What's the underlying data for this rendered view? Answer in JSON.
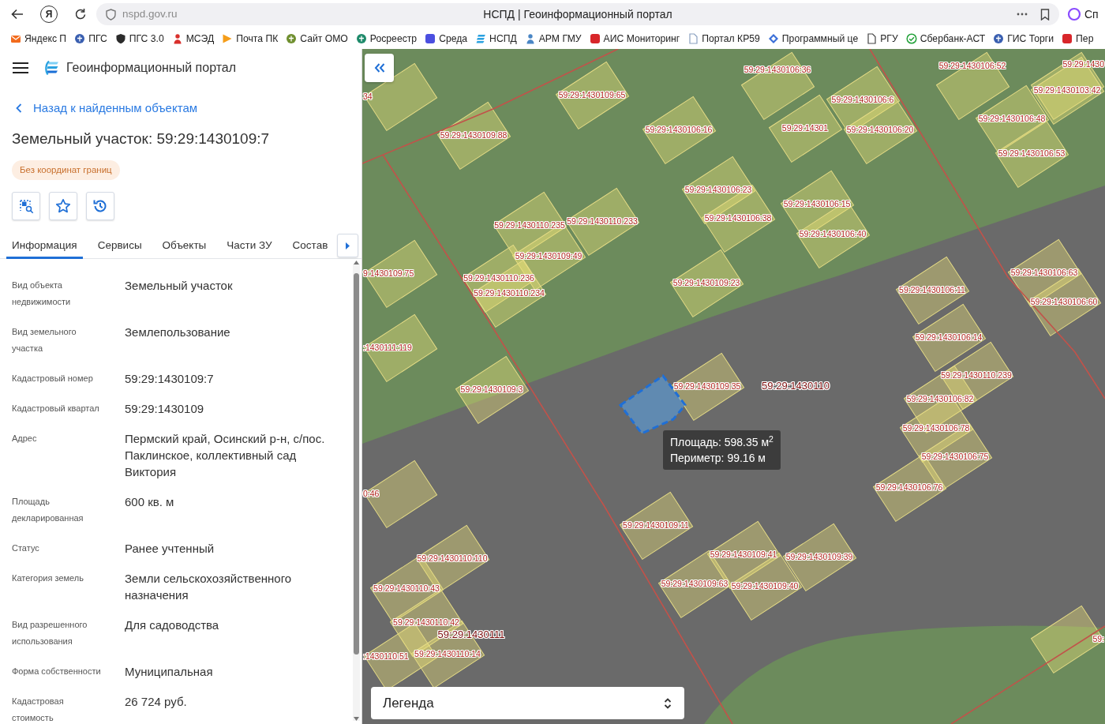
{
  "browser": {
    "yandex_button": "Я",
    "address": "nspd.gov.ru",
    "page_title": "НСПД | Геоинформационный портал",
    "assistant_label": "Сп"
  },
  "bookmarks": [
    "Яндекс П",
    "ПГС",
    "ПГС 3.0",
    "МСЭД",
    "Почта ПК",
    "Сайт ОМО",
    "Росреестр",
    "Среда",
    "НСПД",
    "АРМ ГМУ",
    "АИС Мониторинг",
    "Портал КР59",
    "Программный це",
    "РГУ",
    "Сбербанк-АСТ",
    "ГИС Торги",
    "Пер"
  ],
  "app_header": {
    "title": "Геоинформационный портал"
  },
  "back_link": "Назад к найденным объектам",
  "object": {
    "title": "Земельный участок: 59:29:1430109:7",
    "badge": "Без координат границ"
  },
  "tabs": [
    {
      "label": "Информация",
      "selected": true
    },
    {
      "label": "Сервисы",
      "selected": false
    },
    {
      "label": "Объекты",
      "selected": false
    },
    {
      "label": "Части ЗУ",
      "selected": false
    },
    {
      "label": "Состав",
      "selected": false
    }
  ],
  "properties": [
    {
      "label": "Вид объекта недвижимости",
      "value": "Земельный участок"
    },
    {
      "label": "Вид земельного участка",
      "value": "Землепользование"
    },
    {
      "label": "Кадастровый номер",
      "value": "59:29:1430109:7"
    },
    {
      "label": "Кадастровый квартал",
      "value": "59:29:1430109"
    },
    {
      "label": "Адрес",
      "value": "Пермский край, Осинский р-н, с/пос. Паклинское, коллективный сад Виктория"
    },
    {
      "label": "Площадь декларированная",
      "value": "600 кв. м"
    },
    {
      "label": "Статус",
      "value": "Ранее учтенный"
    },
    {
      "label": "Категория земель",
      "value": "Земли сельскохозяйственного назначения"
    },
    {
      "label": "Вид разрешенного использования",
      "value": "Для садоводства"
    },
    {
      "label": "Форма собственности",
      "value": "Муниципальная"
    },
    {
      "label": "Кадастровая стоимость",
      "value": "26 724 руб."
    }
  ],
  "map": {
    "labels": [
      {
        "text": "59:29:1430106:36",
        "kind": "parcel"
      },
      {
        "text": "59:29:1430106:52",
        "kind": "parcel"
      },
      {
        "text": "59:29:1430",
        "kind": "parcel"
      },
      {
        "text": "34",
        "kind": "parcel"
      },
      {
        "text": "59:29:1430109:65",
        "kind": "parcel"
      },
      {
        "text": "59:29:1430103:42",
        "kind": "parcel"
      },
      {
        "text": "59:29:1430106:6",
        "kind": "parcel"
      },
      {
        "text": "59:29:1430106:48",
        "kind": "parcel"
      },
      {
        "text": "59:29:1430109:88",
        "kind": "parcel"
      },
      {
        "text": "59:29:1430106:16",
        "kind": "parcel"
      },
      {
        "text": "59:29:14301",
        "kind": "parcel"
      },
      {
        "text": "59:29:1430106:20",
        "kind": "parcel"
      },
      {
        "text": "59:29:1430106:53",
        "kind": "parcel"
      },
      {
        "text": "59:29:1430106:23",
        "kind": "parcel"
      },
      {
        "text": "59:29:1430106:15",
        "kind": "parcel"
      },
      {
        "text": "59:29:1430110:235",
        "kind": "parcel"
      },
      {
        "text": "59:29:1430110:233",
        "kind": "parcel"
      },
      {
        "text": "59:29:1430106:38",
        "kind": "parcel"
      },
      {
        "text": "59:29:1430106:40",
        "kind": "parcel"
      },
      {
        "text": "59:29:1430109:49",
        "kind": "parcel"
      },
      {
        "text": "9:1430109:75",
        "kind": "parcel"
      },
      {
        "text": "59:29:1430110:236",
        "kind": "parcel"
      },
      {
        "text": "59:29:1430106:63",
        "kind": "parcel"
      },
      {
        "text": "59:29:1430109:23",
        "kind": "parcel"
      },
      {
        "text": "59:29:1430110:234",
        "kind": "parcel"
      },
      {
        "text": "59:29:1430106:11",
        "kind": "parcel"
      },
      {
        "text": "59:29:1430106:60",
        "kind": "parcel"
      },
      {
        "text": "59:29:1430106:14",
        "kind": "parcel"
      },
      {
        "text": ":1430111:119",
        "kind": "parcel"
      },
      {
        "text": "59:29:1430110:239",
        "kind": "parcel"
      },
      {
        "text": "59:29:1430109:3",
        "kind": "parcel"
      },
      {
        "text": "59:29:1430109:35",
        "kind": "parcel"
      },
      {
        "text": "59:29:1430110",
        "kind": "quarter"
      },
      {
        "text": "59:29:1430106:82",
        "kind": "parcel"
      },
      {
        "text": "59:29:1430106:78",
        "kind": "parcel"
      },
      {
        "text": "59:29:1430106:75",
        "kind": "parcel"
      },
      {
        "text": "0:46",
        "kind": "parcel"
      },
      {
        "text": "59:29:1430106:76",
        "kind": "parcel"
      },
      {
        "text": "59:29:1430109:11",
        "kind": "parcel"
      },
      {
        "text": "59:29:1430110:110",
        "kind": "parcel"
      },
      {
        "text": "59:29:1430109:41",
        "kind": "parcel"
      },
      {
        "text": "59:29:1430109:39",
        "kind": "parcel"
      },
      {
        "text": "59:29:1430110:43",
        "kind": "parcel"
      },
      {
        "text": "59:29:1430109:63",
        "kind": "parcel"
      },
      {
        "text": "59:29:1430109:40",
        "kind": "parcel"
      },
      {
        "text": "59:29:1430110:42",
        "kind": "parcel"
      },
      {
        "text": "59:29:1430111",
        "kind": "quarter"
      },
      {
        "text": "59:",
        "kind": "parcel"
      },
      {
        "text": ":1430110:51",
        "kind": "parcel"
      },
      {
        "text": "59:29:1430110:14",
        "kind": "parcel"
      }
    ],
    "measurement": {
      "area": "Площадь: 598.35 м$^{2}$",
      "perimeter": "Периметр: 99.16 м"
    },
    "legend": "Легенда"
  }
}
